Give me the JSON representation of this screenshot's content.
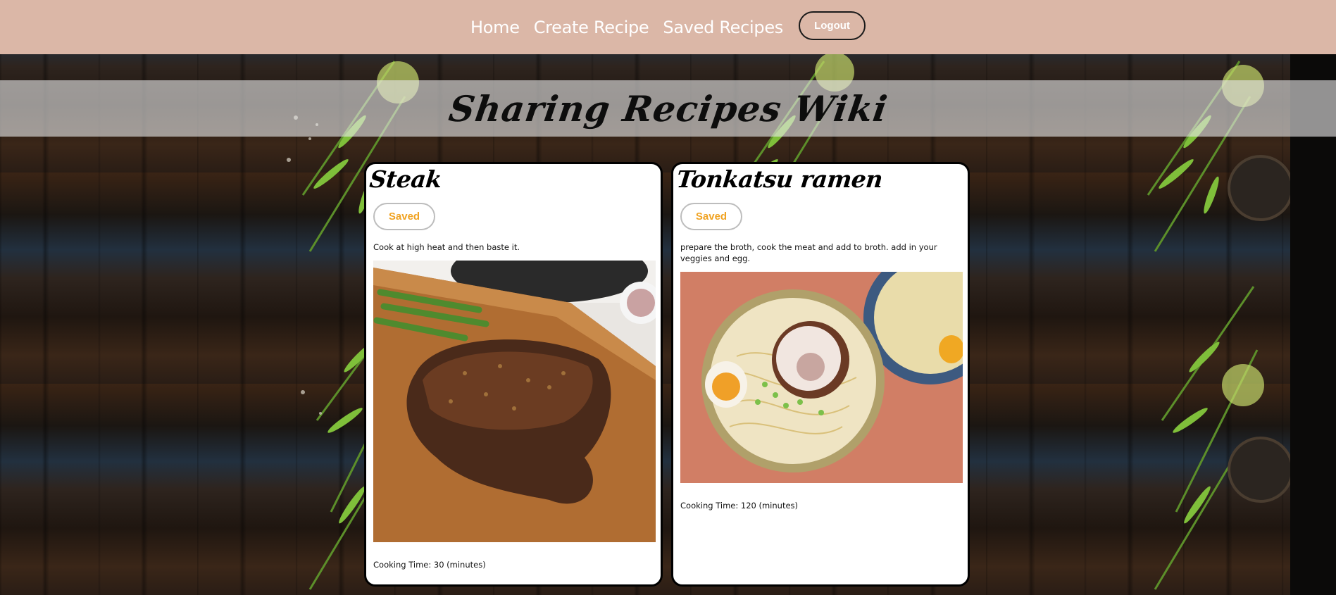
{
  "nav": {
    "home": "Home",
    "create_recipe": "Create Recipe",
    "saved_recipes": "Saved Recipes",
    "logout": "Logout"
  },
  "banner": {
    "title": "Sharing Recipes Wiki"
  },
  "recipes": [
    {
      "name": "Steak",
      "saved_label": "Saved",
      "instructions": "Cook at high heat and then baste it.",
      "image": "steak-on-cutting-board-photo",
      "cooking_time": "Cooking Time: 30 (minutes)"
    },
    {
      "name": "Tonkatsu ramen",
      "saved_label": "Saved",
      "instructions": "prepare the broth, cook the meat and add to broth. add in your veggies and egg.",
      "image": "ramen-bowl-photo",
      "cooking_time": "Cooking Time: 120 (minutes)"
    }
  ],
  "colors": {
    "navbar": "#dbb7a7",
    "saved_text": "#f0a323",
    "card_bg": "#ffffff"
  }
}
